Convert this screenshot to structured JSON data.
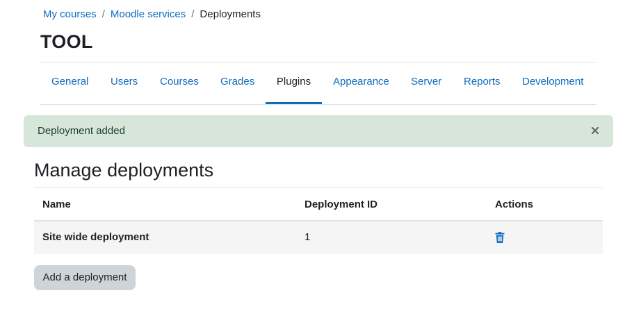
{
  "breadcrumb": {
    "items": [
      "My courses",
      "Moodle services"
    ],
    "separator": "/",
    "current": "Deployments"
  },
  "page": {
    "title": "TOOL"
  },
  "tabs": [
    {
      "label": "General"
    },
    {
      "label": "Users"
    },
    {
      "label": "Courses"
    },
    {
      "label": "Grades"
    },
    {
      "label": "Plugins",
      "active": true
    },
    {
      "label": "Appearance"
    },
    {
      "label": "Server"
    },
    {
      "label": "Reports"
    },
    {
      "label": "Development"
    }
  ],
  "alert": {
    "message": "Deployment added",
    "close_icon": "close-icon"
  },
  "section": {
    "title": "Manage deployments"
  },
  "table": {
    "headers": [
      "Name",
      "Deployment ID",
      "Actions"
    ],
    "rows": [
      {
        "name": "Site wide deployment",
        "id": "1",
        "action_icon": "trash-icon"
      }
    ]
  },
  "add_button": {
    "label": "Add a deployment"
  },
  "colors": {
    "link": "#0f6cbf",
    "alert_bg": "#d7e6da",
    "button_bg": "#ced4da",
    "row_bg": "#f5f5f5"
  }
}
